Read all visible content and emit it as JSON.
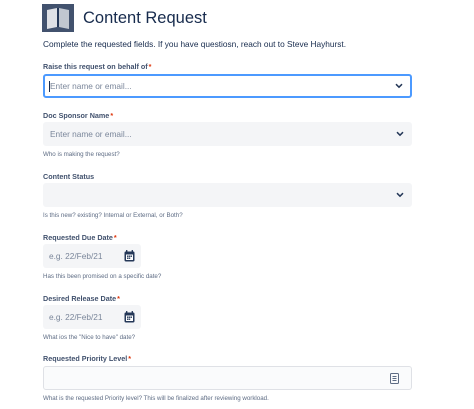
{
  "form": {
    "title": "Content Request",
    "intro": "Complete the requested fields. If you have questiosn, reach out to Steve Hayhurst."
  },
  "fields": {
    "raise_on_behalf": {
      "label": "Raise this request on behalf of",
      "required": "*",
      "placeholder": "Enter name or email..."
    },
    "doc_sponsor": {
      "label": "Doc Sponsor Name",
      "required": "*",
      "placeholder": "Enter name or email...",
      "help": "Who is making the request?"
    },
    "content_status": {
      "label": "Content Status",
      "value": "",
      "help": "Is this new? existing? Internal or External, or Both?"
    },
    "requested_due_date": {
      "label": "Requested Due Date",
      "required": "*",
      "placeholder": "e.g. 22/Feb/21",
      "help": "Has this been promised on a specific date?"
    },
    "desired_release_date": {
      "label": "Desired Release Date",
      "required": "*",
      "placeholder": "e.g. 22/Feb/21",
      "help": "What ios the \"Nice to have\" date?"
    },
    "requested_priority": {
      "label": "Requested Priority Level",
      "required": "*",
      "value": "",
      "help": "What is the requested Priority level? This will be finalized after reviewing workload."
    }
  },
  "icons": {
    "header": "book-icon",
    "dropdown": "chevron-down-icon",
    "date": "calendar-icon",
    "field_action": "list-icon"
  },
  "colors": {
    "focus_border": "#4c9aff",
    "required_asterisk": "#de350b",
    "icon_dark": "#253858",
    "header_icon": "#42526e"
  }
}
